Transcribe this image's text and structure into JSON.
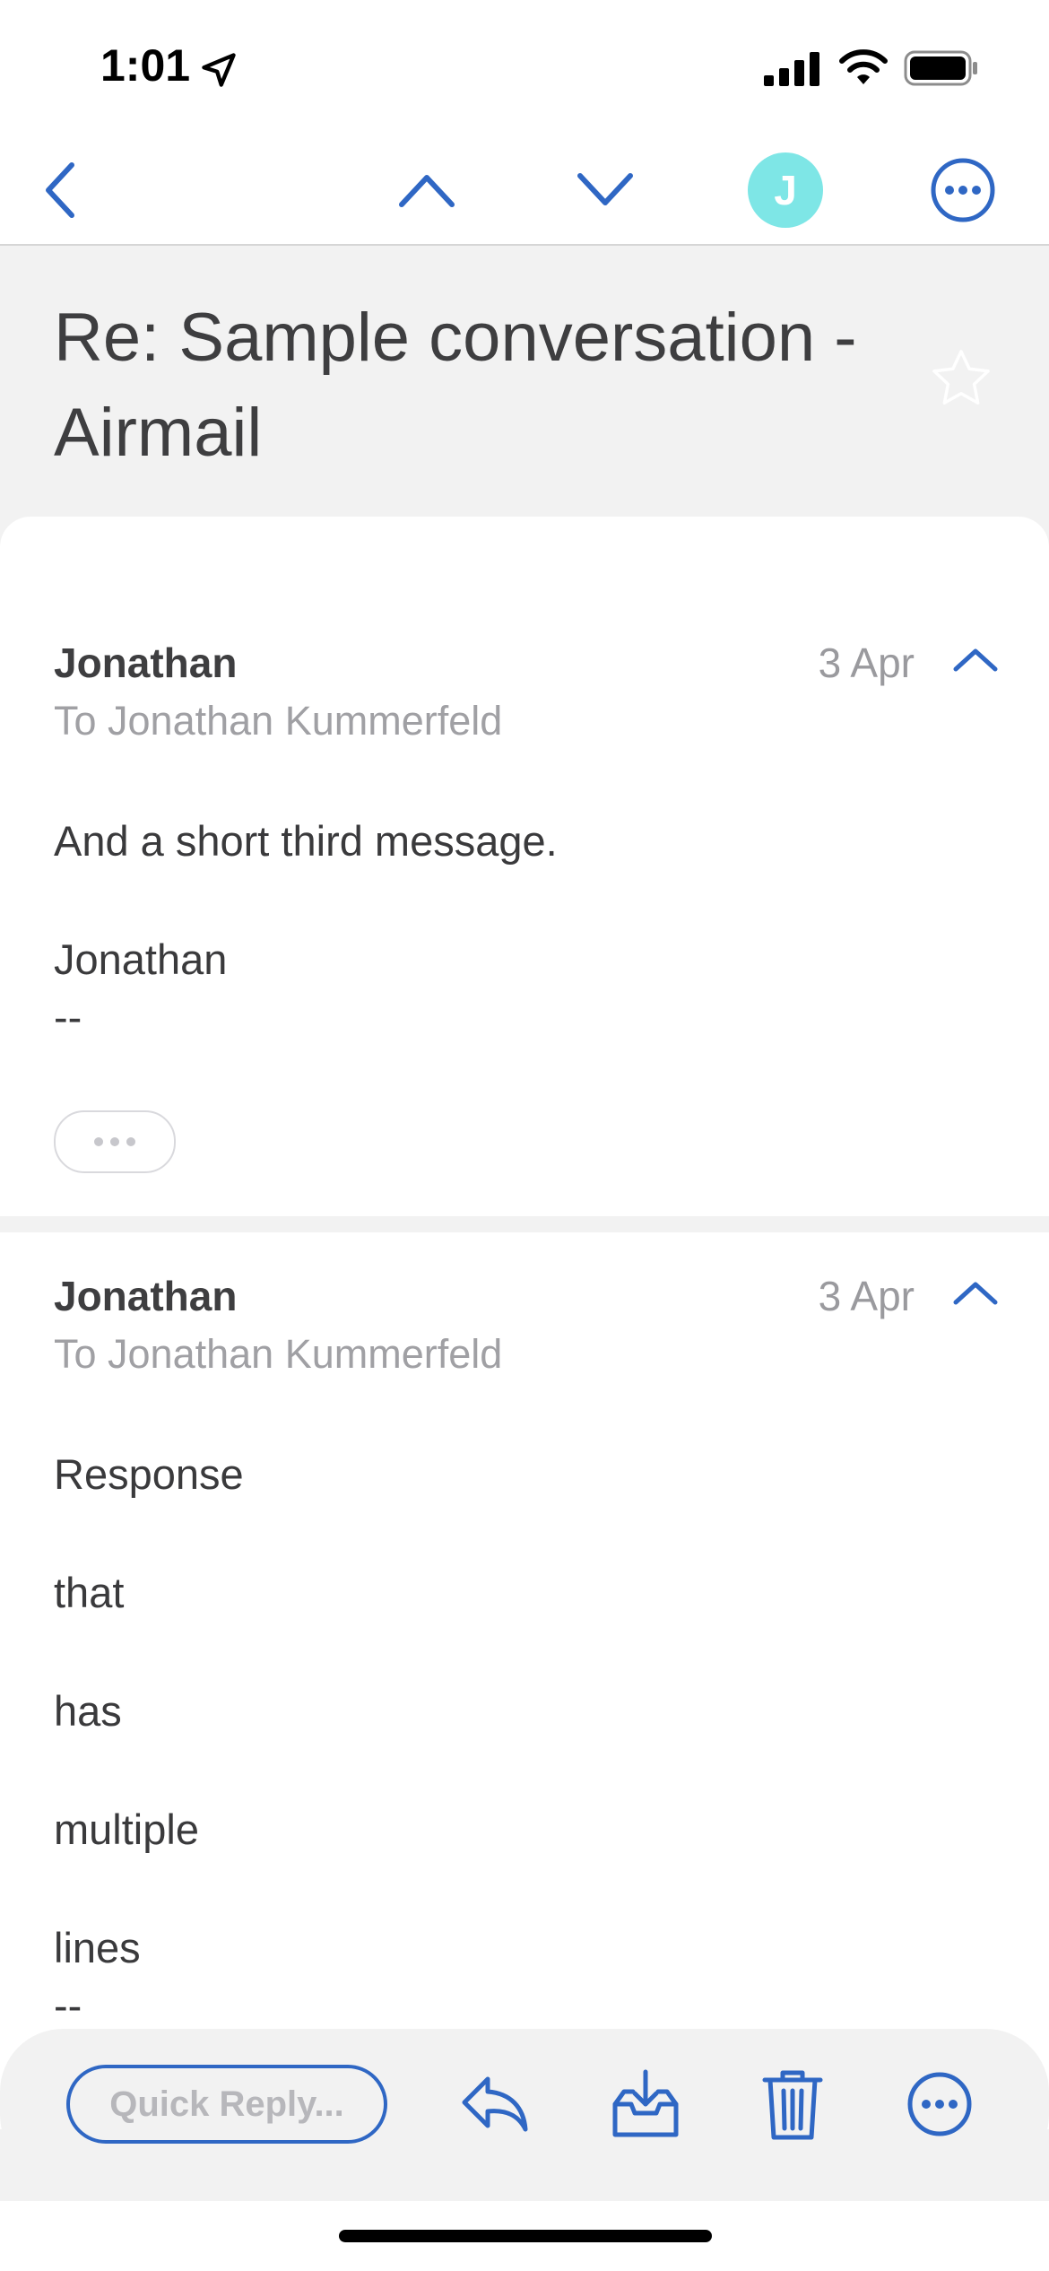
{
  "status_bar": {
    "time": "1:01"
  },
  "nav": {
    "avatar_letter": "J"
  },
  "subject": "Re: Sample conversation - Airmail",
  "messages": [
    {
      "sender": "Jonathan",
      "recipient": "To Jonathan Kummerfeld",
      "date": "3 Apr",
      "body": [
        "And a short third message.",
        "Jonathan",
        "--"
      ]
    },
    {
      "sender": "Jonathan",
      "recipient": "To Jonathan Kummerfeld",
      "date": "3 Apr",
      "body": [
        "Response",
        "that",
        "has",
        "multiple",
        "lines",
        "--"
      ]
    }
  ],
  "toolbar": {
    "quick_reply_label": "Quick Reply..."
  },
  "colors": {
    "accent": "#2f67c4",
    "avatar": "#7ee6e6"
  },
  "icons": [
    "back-chevron-icon",
    "up-chevron-icon",
    "down-chevron-icon",
    "more-icon",
    "star-icon",
    "reply-icon",
    "archive-icon",
    "trash-icon"
  ]
}
